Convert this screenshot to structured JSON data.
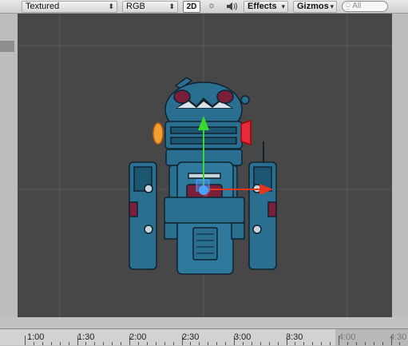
{
  "toolbar": {
    "draw_mode": "Textured",
    "render_mode": "RGB",
    "mode_2d": "2D",
    "effects": "Effects",
    "gizmos": "Gizmos",
    "search_placeholder": "All",
    "lighting_icon": "sun-icon",
    "audio_icon": "speaker-icon"
  },
  "timeline": {
    "labels": [
      "1:00",
      "1:30",
      "2:00",
      "2:30",
      "3:00",
      "3:30",
      "4:00",
      "4:30"
    ]
  },
  "colors": {
    "scene_bg": "#474747",
    "robot_body": "#2a6f8f",
    "gizmo_y": "#3ad82c",
    "gizmo_x": "#e8361c",
    "gizmo_center": "#4aa3ff"
  }
}
